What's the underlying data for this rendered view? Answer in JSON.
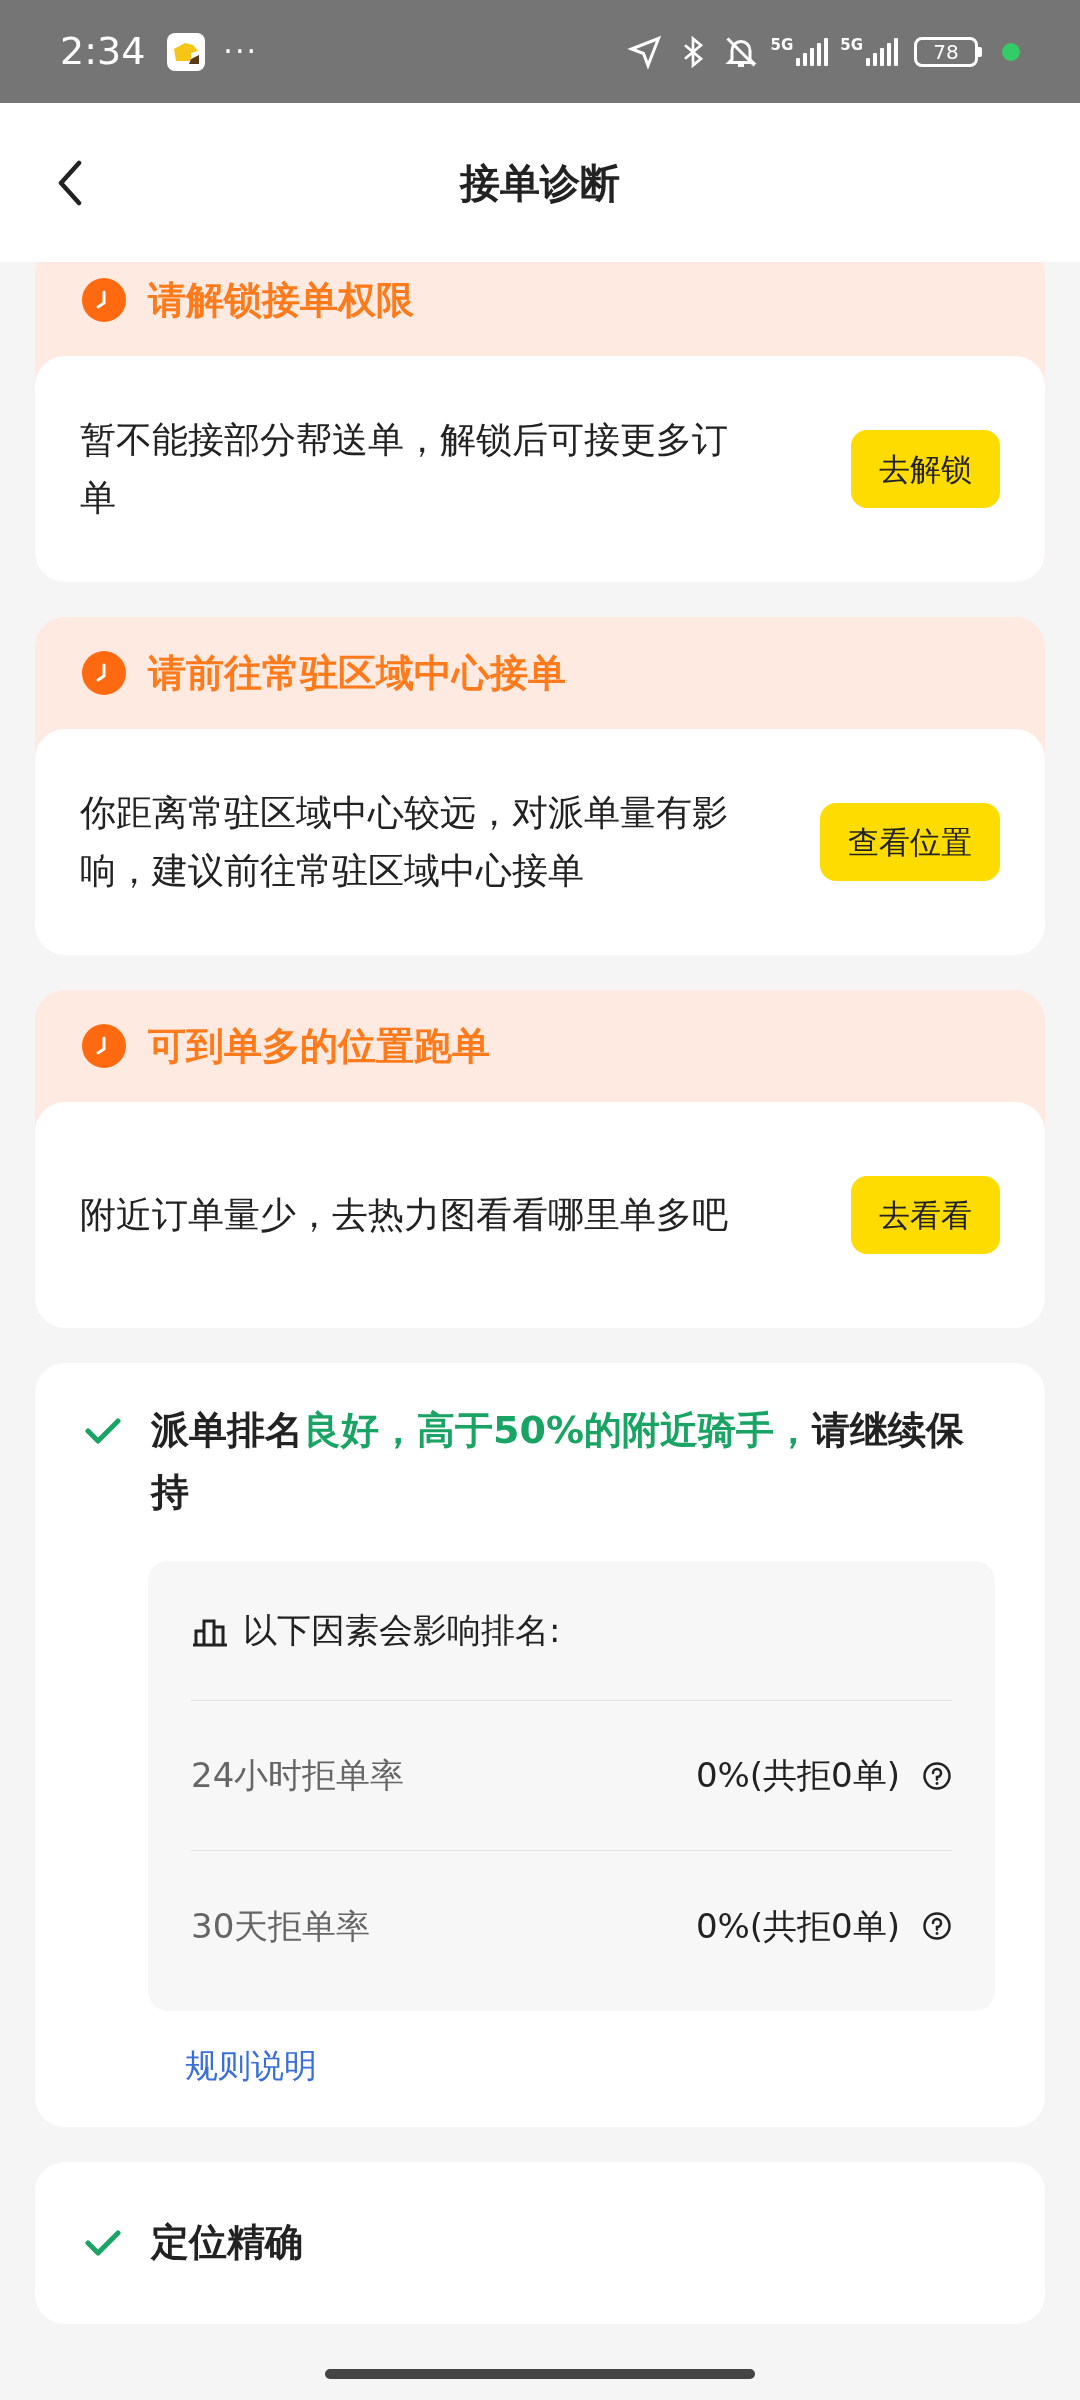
{
  "status_bar": {
    "time": "2:34",
    "more": "···",
    "network_labels": [
      "5G",
      "5G"
    ],
    "battery": "78"
  },
  "header": {
    "title": "接单诊断"
  },
  "issues": [
    {
      "title": "请解锁接单权限",
      "message": "暂不能接部分帮送单，解锁后可接更多订单",
      "button": "去解锁"
    },
    {
      "title": "请前往常驻区域中心接单",
      "message": "你距离常驻区域中心较远，对派单量有影响，建议前往常驻区域中心接单",
      "button": "查看位置"
    },
    {
      "title": "可到单多的位置跑单",
      "message": "附近订单量少，去热力图看看哪里单多吧",
      "button": "去看看"
    }
  ],
  "ranking": {
    "segments": [
      {
        "text": "派单排名",
        "kind": "normal"
      },
      {
        "text": "良好，高于50%的附近骑手，",
        "kind": "highlight"
      },
      {
        "text": "请继续保持",
        "kind": "normal"
      }
    ],
    "factors_title": "以下因素会影响排名:",
    "factors": [
      {
        "label": "24小时拒单率",
        "value": "0%(共拒0单)"
      },
      {
        "label": "30天拒单率",
        "value": "0%(共拒0单)"
      }
    ],
    "rules_link": "规则说明"
  },
  "location": {
    "text": "定位精确"
  }
}
